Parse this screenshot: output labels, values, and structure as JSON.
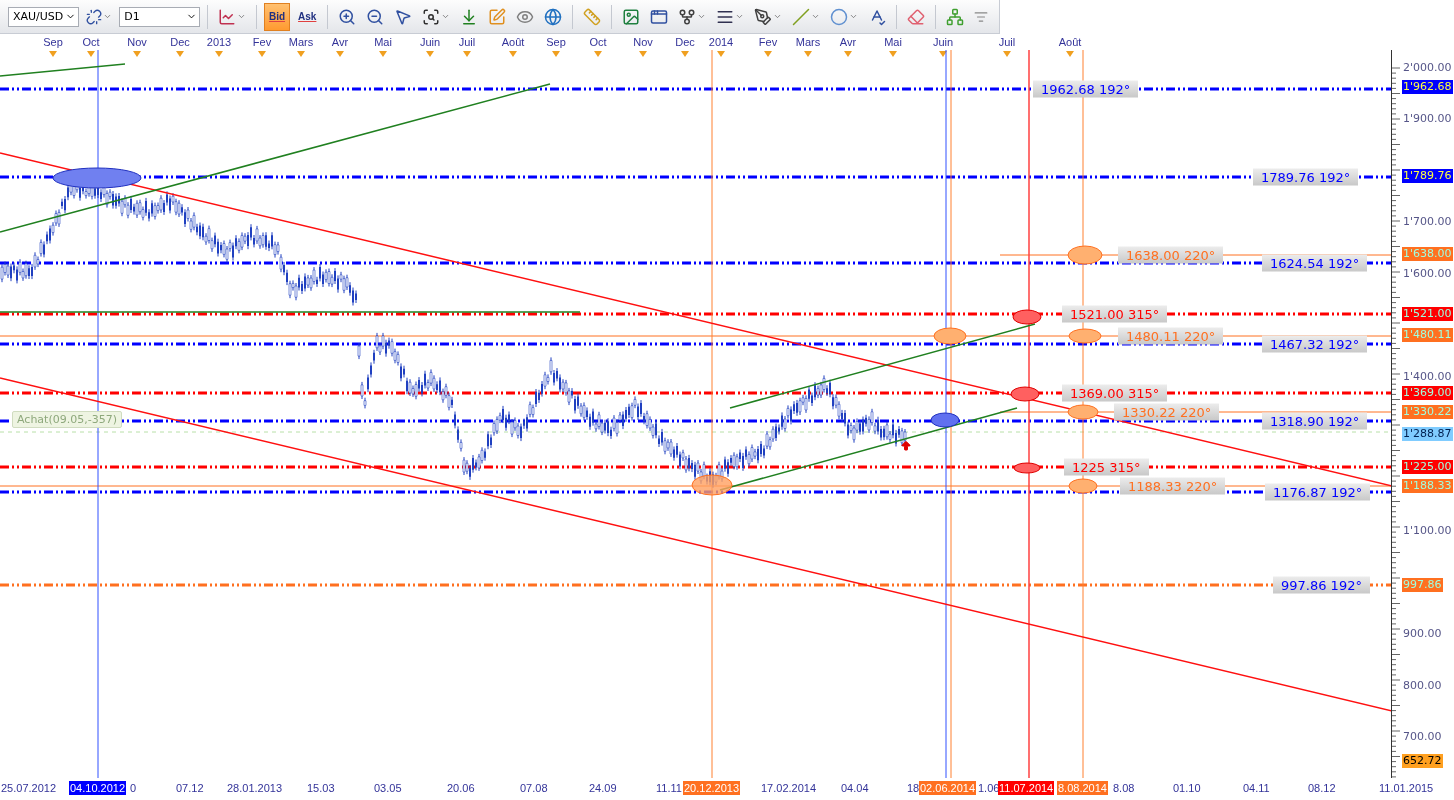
{
  "toolbar": {
    "symbol": "XAU/USD",
    "timeframe": "D1",
    "price_modes": [
      {
        "label": "Bid",
        "selected": true
      },
      {
        "label": "Ask",
        "selected": false
      }
    ]
  },
  "month_axis": [
    "Sep",
    "Oct",
    "Nov",
    "Dec",
    "2013",
    "Fev",
    "Mars",
    "Avr",
    "Mai",
    "Juin",
    "Juil",
    "Août",
    "Sep",
    "Oct",
    "Nov",
    "Dec",
    "2014",
    "Fev",
    "Mars",
    "Avr",
    "Mai",
    "Juin",
    "Juil",
    "Août"
  ],
  "chart": {
    "position_label": "Achat(09.05,-357)",
    "levels": [
      {
        "kind": "dashdot",
        "text": "1962.68 192°",
        "color": "#0000ff"
      },
      {
        "kind": "dashdot",
        "text": "1789.76 192°",
        "color": "#0000ff"
      },
      {
        "kind": "solid",
        "text": "1638.00 220°",
        "color": "#ff7020"
      },
      {
        "kind": "dashdot",
        "text": "1624.54 192°",
        "color": "#0000ff"
      },
      {
        "kind": "dashdot",
        "text": "1521.00 315°",
        "color": "#ff0000"
      },
      {
        "kind": "solid",
        "text": "1480.11 220°",
        "color": "#ff7020"
      },
      {
        "kind": "dashdot",
        "text": "1467.32 192°",
        "color": "#0000ff"
      },
      {
        "kind": "dashdot",
        "text": "1369.00 315°",
        "color": "#ff0000"
      },
      {
        "kind": "solid",
        "text": "1330.22 220°",
        "color": "#ff7020"
      },
      {
        "kind": "dashdot",
        "text": "1318.90 192°",
        "color": "#0000ff"
      },
      {
        "kind": "dashdot",
        "text": "1225 315°",
        "color": "#ff0000"
      },
      {
        "kind": "solid",
        "text": "1188.33 220°",
        "color": "#ff7020"
      },
      {
        "kind": "dashdot",
        "text": "1176.87 192°",
        "color": "#0000ff"
      },
      {
        "kind": "dashdot_orange",
        "text": "997.86 192°",
        "color": "#0000ff"
      }
    ]
  },
  "price_axis": [
    {
      "kind": "tick",
      "text": "2'000.00"
    },
    {
      "kind": "marker",
      "text": "1'962.68",
      "color": "#0000ff"
    },
    {
      "kind": "tick",
      "text": "1'900.00"
    },
    {
      "kind": "marker",
      "text": "1'789.76",
      "color": "#0000ff"
    },
    {
      "kind": "tick",
      "text": "1'700.00"
    },
    {
      "kind": "marker",
      "text": "1'638.00",
      "color": "#ff7020"
    },
    {
      "kind": "tick",
      "text": "1'600.00"
    },
    {
      "kind": "marker",
      "text": "1'521.00",
      "color": "#ff0000"
    },
    {
      "kind": "marker",
      "text": "1'480.11",
      "color": "#ff7020"
    },
    {
      "kind": "tick",
      "text": "1'400.00"
    },
    {
      "kind": "marker",
      "text": "1'369.00",
      "color": "#ff0000"
    },
    {
      "kind": "marker",
      "text": "1'330.22",
      "color": "#ff7020"
    },
    {
      "kind": "marker",
      "text": "1'288.87",
      "color": "#80ccff"
    },
    {
      "kind": "marker",
      "text": "1'225.00",
      "color": "#ff0000"
    },
    {
      "kind": "marker",
      "text": "1'188.33",
      "color": "#ff7020"
    },
    {
      "kind": "tick",
      "text": "1'100.00"
    },
    {
      "kind": "marker",
      "text": "997.86",
      "color": "#ff7020"
    },
    {
      "kind": "tick",
      "text": "900.00"
    },
    {
      "kind": "tick",
      "text": "800.00"
    },
    {
      "kind": "tick",
      "text": "700.00"
    },
    {
      "kind": "marker",
      "text": "652.72",
      "color": "#ffa020"
    }
  ],
  "date_axis": [
    {
      "text": "25.07.2012"
    },
    {
      "text": "04.10.2012",
      "color": "#0000ff"
    },
    {
      "text": "0"
    },
    {
      "text": "07.12"
    },
    {
      "text": "28.01.2013"
    },
    {
      "text": "15.03"
    },
    {
      "text": "03.05"
    },
    {
      "text": "20.06"
    },
    {
      "text": "07.08"
    },
    {
      "text": "24.09"
    },
    {
      "text": "11.11"
    },
    {
      "text": "20.12.2013",
      "color": "#ff7020"
    },
    {
      "text": "17.02.2014"
    },
    {
      "text": "04.04"
    },
    {
      "text": "18"
    },
    {
      "text": "02.06.2014",
      "color": "#ff7020"
    },
    {
      "text": "1.06"
    },
    {
      "text": "11.07.2014",
      "color": "#ff0000"
    },
    {
      "text": "8.08.2014",
      "color": "#ff7020"
    },
    {
      "text": "8.08"
    },
    {
      "text": "01.10"
    },
    {
      "text": "04.11"
    },
    {
      "text": "08.12"
    },
    {
      "text": "11.01.2015"
    }
  ]
}
